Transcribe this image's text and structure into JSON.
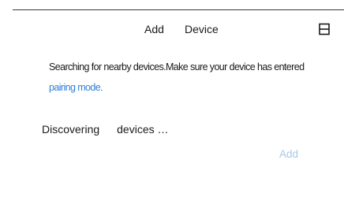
{
  "header": {
    "title_word_1": "Add",
    "title_word_2": "Device",
    "scan_icon": "scan-icon"
  },
  "instructions": {
    "text": "Searching for nearby devices.Make sure your device has entered ",
    "link_text": "pairing mode."
  },
  "status": {
    "word_1": "Discovering",
    "word_2": "devices …"
  },
  "actions": {
    "add_label": "Add"
  },
  "colors": {
    "link": "#2f7fd6",
    "add_disabled": "#a9c7e3",
    "text": "#1a1a1a"
  }
}
